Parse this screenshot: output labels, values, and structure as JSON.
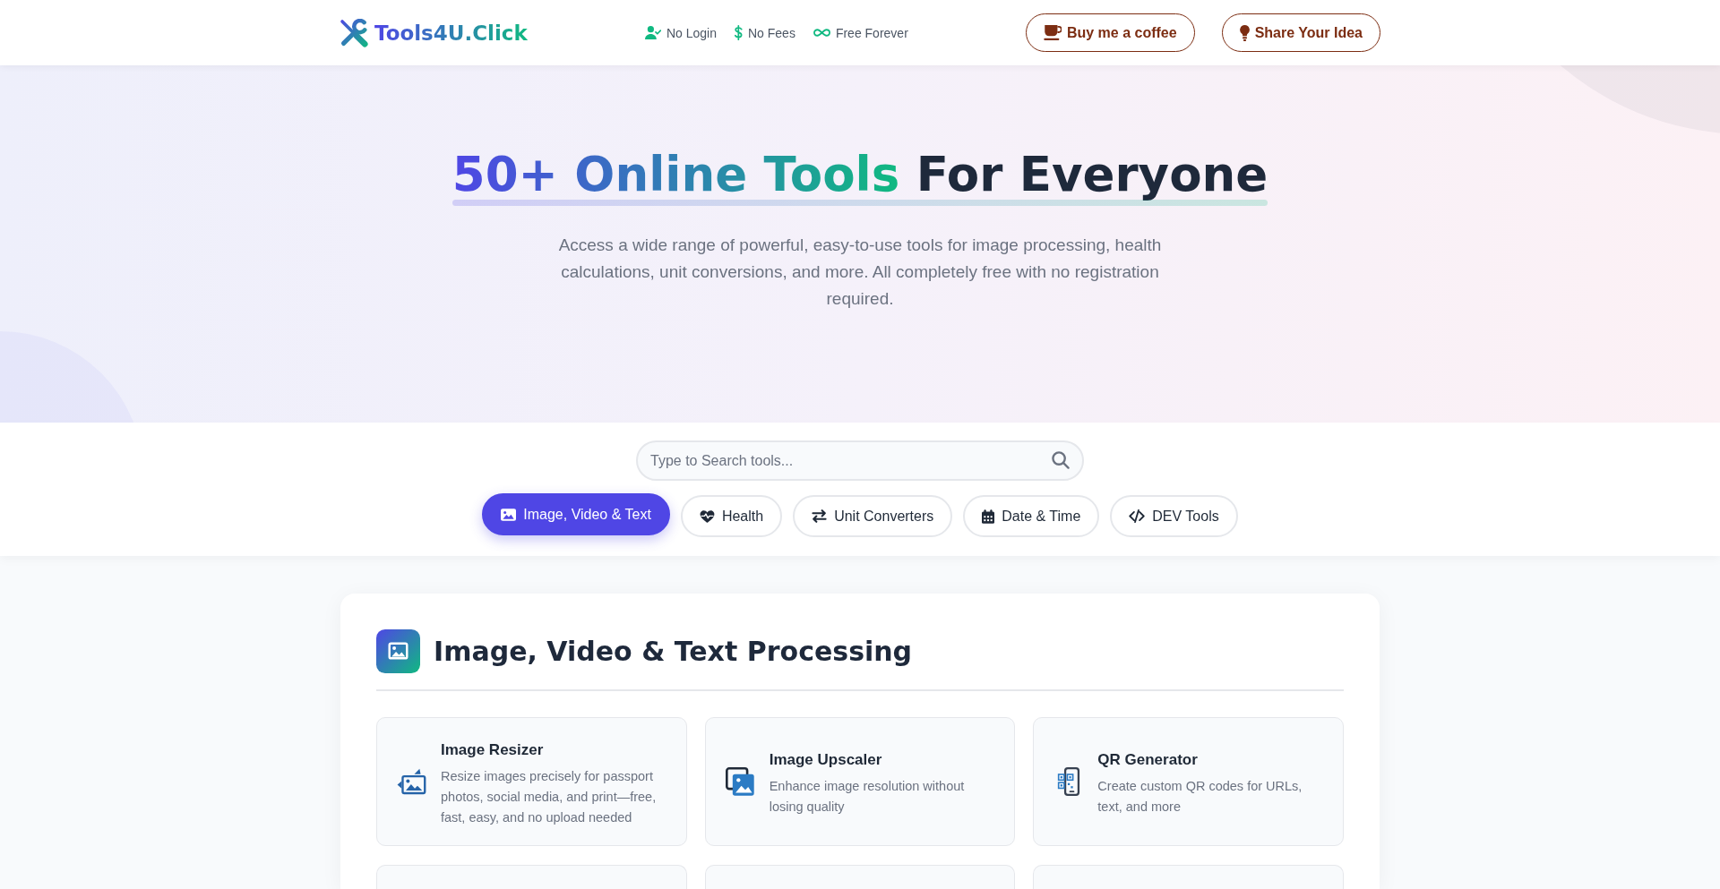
{
  "header": {
    "logo": "Tools4U.Click",
    "features": [
      "No Login",
      "No Fees",
      "Free Forever"
    ],
    "buttons": [
      "Buy me a coffee",
      "Share Your Idea"
    ]
  },
  "hero": {
    "title_highlight": "50+ Online Tools",
    "title_rest": "For Everyone",
    "subtitle": "Access a wide range of powerful, easy-to-use tools for image processing, health calculations, unit conversions, and more. All completely free with no registration required."
  },
  "search": {
    "placeholder": "Type to Search tools..."
  },
  "category_tabs": [
    {
      "label": "Image, Video & Text",
      "selected": true
    },
    {
      "label": "Health",
      "selected": false
    },
    {
      "label": "Unit Converters",
      "selected": false
    },
    {
      "label": "Date & Time",
      "selected": false
    },
    {
      "label": "DEV Tools",
      "selected": false
    }
  ],
  "section": {
    "title": "Image, Video & Text Processing",
    "cards": [
      {
        "kind": "tool",
        "title": "Image Resizer",
        "description": "Resize images precisely for passport photos, social media, and print—free, fast, easy, and no upload needed"
      },
      {
        "kind": "tool",
        "title": "Image Upscaler",
        "description": "Enhance image resolution without losing quality"
      },
      {
        "kind": "tool",
        "title": "QR Generator",
        "description": "Create custom QR codes for URLs, text, and more"
      },
      {
        "kind": "cut"
      },
      {
        "kind": "cut"
      },
      {
        "kind": "cut"
      }
    ]
  }
}
